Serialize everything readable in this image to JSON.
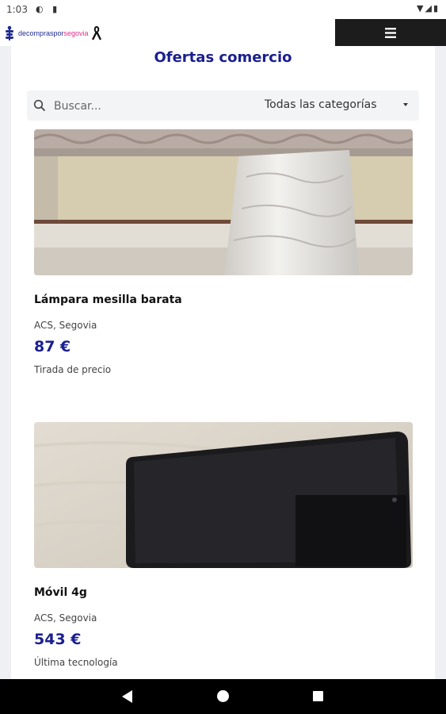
{
  "status": {
    "time": "1:03"
  },
  "header": {
    "logo_part1": "decompraspor",
    "logo_part2": "segovia"
  },
  "page": {
    "title": "Ofertas comercio"
  },
  "search": {
    "placeholder": "Buscar...",
    "category": "Todas las categorías"
  },
  "listings": [
    {
      "title": "Lámpara mesilla barata",
      "location": "ACS, Segovia",
      "price": "87 €",
      "description": "Tirada de precio"
    },
    {
      "title": "Móvil 4g",
      "location": "ACS, Segovia",
      "price": "543 €",
      "description": "Última tecnología"
    }
  ],
  "colors": {
    "accent": "#1a1f8f",
    "brand_pink": "#e0318a",
    "menu_bg": "#1c1c1c"
  }
}
